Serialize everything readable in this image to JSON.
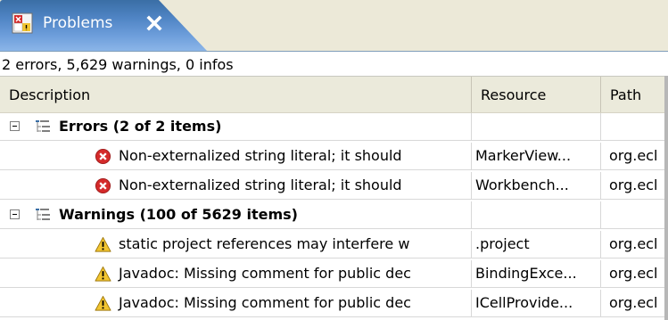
{
  "tab": {
    "title": "Problems",
    "icon": "problems-view-icon",
    "close_icon": "close-icon"
  },
  "summary": "2 errors, 5,629 warnings, 0 infos",
  "columns": [
    "Description",
    "Resource",
    "Path"
  ],
  "rows": [
    {
      "kind": "group",
      "label": "Errors (2 of 2 items)",
      "icon": "group-tree-icon"
    },
    {
      "kind": "item",
      "severity": "error",
      "description": "Non-externalized string literal; it should",
      "resource": "MarkerView...",
      "path": "org.ecl"
    },
    {
      "kind": "item",
      "severity": "error",
      "description": "Non-externalized string literal; it should",
      "resource": "Workbench...",
      "path": "org.ecl"
    },
    {
      "kind": "group",
      "label": "Warnings (100 of 5629 items)",
      "icon": "group-tree-icon"
    },
    {
      "kind": "item",
      "severity": "warning",
      "description": "static project references may interfere w",
      "resource": ".project",
      "path": "org.ecl"
    },
    {
      "kind": "item",
      "severity": "warning",
      "description": "Javadoc: Missing comment for public dec",
      "resource": "BindingExce...",
      "path": "org.ecl"
    },
    {
      "kind": "item",
      "severity": "warning",
      "description": "Javadoc: Missing comment for public dec",
      "resource": "ICellProvide...",
      "path": "org.ecl"
    }
  ],
  "colors": {
    "tab_gradient_top": "#3a6ea5",
    "tab_gradient_bottom": "#8bb5e8",
    "error": "#d42a2a",
    "warning": "#f2c530",
    "header_bg": "#ebeadb"
  }
}
